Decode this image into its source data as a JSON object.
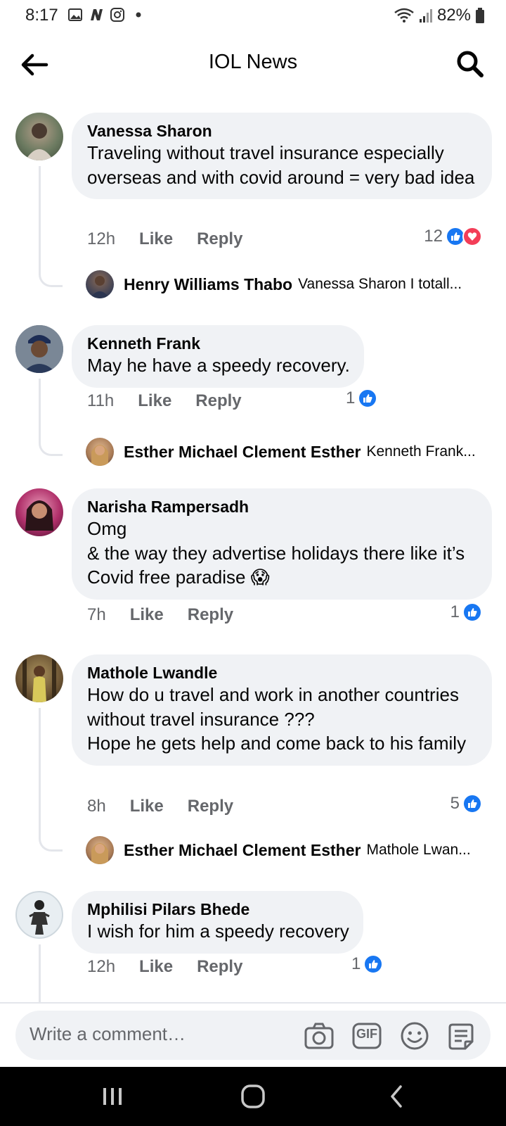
{
  "status_bar": {
    "time": "8:17",
    "battery": "82%"
  },
  "header": {
    "title": "IOL News"
  },
  "colors": {
    "accent": "#1877f2",
    "love": "#f33e58",
    "bubble": "#f0f2f5",
    "meta": "#65676b"
  },
  "comments": [
    {
      "author": "Vanessa Sharon",
      "text": "Traveling without travel insurance especially overseas and with covid around = very bad idea",
      "time": "12h",
      "like_label": "Like",
      "reply_label": "Reply",
      "reaction_count": "12",
      "reactions": [
        "like-icon",
        "love-icon"
      ],
      "reply": {
        "author": "Henry Williams Thabo",
        "preview": "Vanessa Sharon I totall..."
      }
    },
    {
      "author": "Kenneth Frank",
      "text": "May he have a speedy recovery.",
      "time": "11h",
      "like_label": "Like",
      "reply_label": "Reply",
      "reaction_count": "1",
      "reactions": [
        "like-icon"
      ],
      "reply": {
        "author": "Esther Michael Clement Esther",
        "preview": "Kenneth Frank..."
      }
    },
    {
      "author": "Narisha Rampersadh",
      "text": "Omg\n& the way they advertise holidays there like it’s Covid free paradise 😱",
      "time": "7h",
      "like_label": "Like",
      "reply_label": "Reply",
      "reaction_count": "1",
      "reactions": [
        "like-icon"
      ]
    },
    {
      "author": "Mathole Lwandle",
      "text": "How do u travel and work in another countries without travel insurance ???\nHope he gets help and come back to his family",
      "time": "8h",
      "like_label": "Like",
      "reply_label": "Reply",
      "reaction_count": "5",
      "reactions": [
        "like-icon"
      ],
      "reply": {
        "author": "Esther Michael Clement Esther",
        "preview": "Mathole Lwan..."
      }
    },
    {
      "author": "Mphilisi Pilars Bhede",
      "text": "I wish for him a speedy recovery",
      "time": "12h",
      "like_label": "Like",
      "reply_label": "Reply",
      "reaction_count": "1",
      "reactions": [
        "like-icon"
      ]
    }
  ],
  "composer": {
    "placeholder": "Write a comment…",
    "icons": [
      "camera-icon",
      "gif-icon",
      "emoji-icon",
      "sticker-icon"
    ],
    "gif_label": "GIF"
  }
}
